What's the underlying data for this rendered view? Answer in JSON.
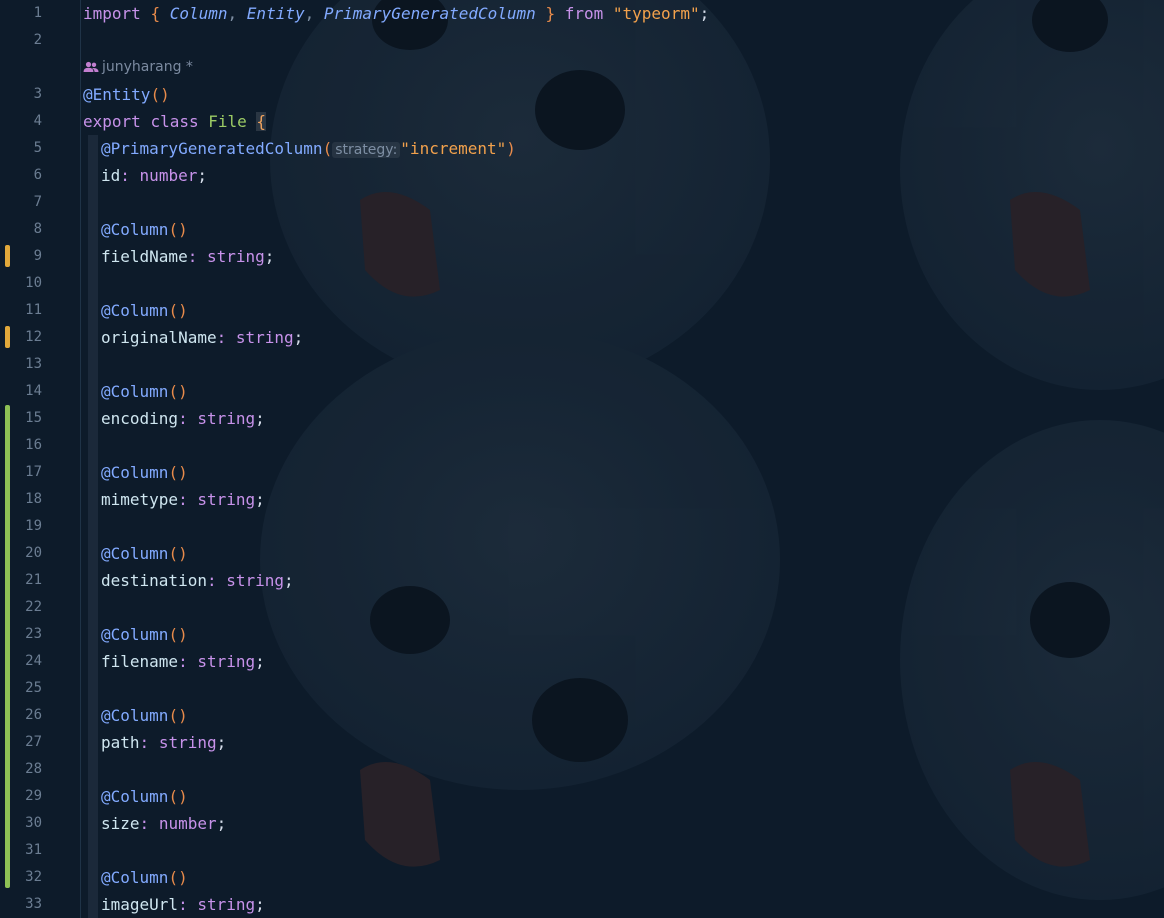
{
  "editor": {
    "codelens": {
      "author": "junyharang",
      "modified_mark": "*"
    },
    "code": {
      "import_kw": "import",
      "open_brace": "{",
      "import_names": [
        "Column",
        "Entity",
        "PrimaryGeneratedColumn"
      ],
      "close_brace": "}",
      "from_kw": "from",
      "module": "\"typeorm\"",
      "semicolon": ";",
      "entity_decorator": "@Entity",
      "call_parens": "()",
      "export_kw": "export",
      "class_kw": "class",
      "class_name": "File",
      "pk_decorator": "@PrimaryGeneratedColumn",
      "pk_open": "(",
      "pk_hint": "strategy:",
      "pk_arg": "\"increment\"",
      "pk_close": ")",
      "id_field": "id",
      "id_type": "number",
      "column_decorator": "@Column",
      "fields": [
        {
          "name": "fieldName",
          "type": "string"
        },
        {
          "name": "originalName",
          "type": "string"
        },
        {
          "name": "encoding",
          "type": "string"
        },
        {
          "name": "mimetype",
          "type": "string"
        },
        {
          "name": "destination",
          "type": "string"
        },
        {
          "name": "filename",
          "type": "string"
        },
        {
          "name": "path",
          "type": "string"
        },
        {
          "name": "size",
          "type": "number"
        },
        {
          "name": "imageUrl",
          "type": "string"
        }
      ]
    },
    "line_numbers": [
      "1",
      "2",
      "3",
      "4",
      "5",
      "6",
      "7",
      "8",
      "9",
      "10",
      "11",
      "12",
      "13",
      "14",
      "15",
      "16",
      "17",
      "18",
      "19",
      "20",
      "21",
      "22",
      "23",
      "24",
      "25",
      "26",
      "27",
      "28",
      "29",
      "30",
      "31",
      "32",
      "33"
    ],
    "gutter_markers": {
      "modified_lines": [
        9,
        12
      ],
      "added_from": 15,
      "added_to": 32
    },
    "colors": {
      "background": "#0d1b2a",
      "modified": "#e2a93b",
      "added": "#8ec155"
    }
  }
}
